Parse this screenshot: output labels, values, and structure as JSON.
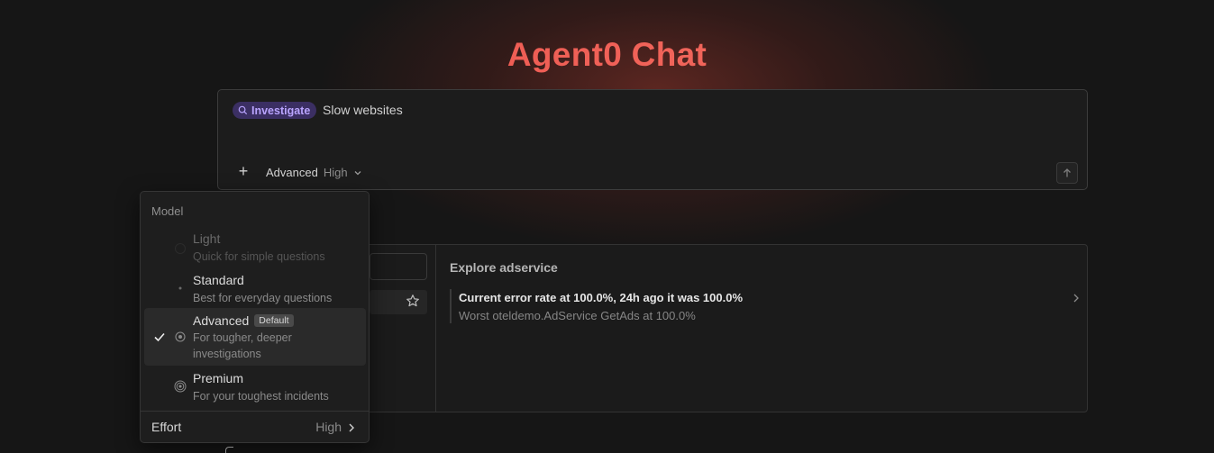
{
  "title": "Agent0 Chat",
  "composer": {
    "chip_label": "Investigate",
    "query": "Slow websites",
    "model": "Advanced",
    "effort": "High"
  },
  "panel": {
    "explore_title": "Explore adservice",
    "item_title": "Current error rate at 100.0%, 24h ago it was 100.0%",
    "item_subtitle": "Worst oteldemo.AdService GetAds at 100.0%"
  },
  "dropdown": {
    "header": "Model",
    "options": [
      {
        "name": "Light",
        "desc": "Quick for simple questions",
        "disabled": true
      },
      {
        "name": "Standard",
        "desc": "Best for everyday questions"
      },
      {
        "name": "Advanced",
        "badge": "Default",
        "desc": "For tougher, deeper investigations",
        "selected": true
      },
      {
        "name": "Premium",
        "desc": "For your toughest incidents"
      }
    ],
    "effort_label": "Effort",
    "effort_value": "High"
  },
  "colors": {
    "accent": "#f0605a",
    "chip_bg": "#3b2f63",
    "chip_text": "#b9a4ff",
    "background": "#161616"
  },
  "icons": [
    "search-icon",
    "plus-icon",
    "chevron-down-icon",
    "arrow-up-icon",
    "star-icon",
    "chevron-right-icon",
    "check-icon",
    "model-level-icon"
  ]
}
